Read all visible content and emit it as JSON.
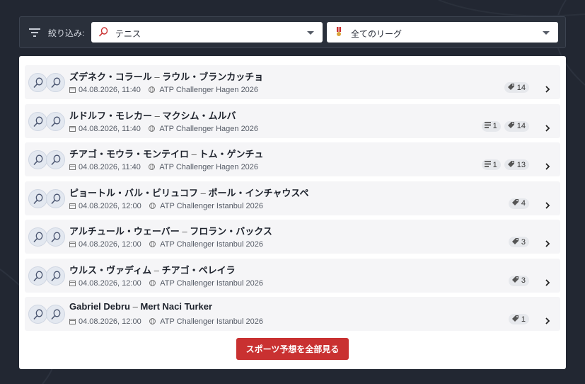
{
  "filter": {
    "label": "絞り込み:",
    "sport": "テニス",
    "league": "全てのリーグ"
  },
  "matches": [
    {
      "home": "ズデネク・コラール",
      "away": "ラウル・ブランカッチョ",
      "date": "04.08.2026, 11:40",
      "league": "ATP Challenger Hagen 2026",
      "news": "",
      "tips": "14"
    },
    {
      "home": "ルドルフ・モレカー",
      "away": "マクシム・ムルバ",
      "date": "04.08.2026, 11:40",
      "league": "ATP Challenger Hagen 2026",
      "news": "1",
      "tips": "14"
    },
    {
      "home": "チアゴ・モウラ・モンテイロ",
      "away": "トム・ゲンチュ",
      "date": "04.08.2026, 11:40",
      "league": "ATP Challenger Hagen 2026",
      "news": "1",
      "tips": "13"
    },
    {
      "home": "ピョートル・バル・ビリュコフ",
      "away": "ポール・インチャウスペ",
      "date": "04.08.2026, 12:00",
      "league": "ATP Challenger Istanbul 2026",
      "news": "",
      "tips": "4"
    },
    {
      "home": "アルチュール・ウェーバー",
      "away": "フロラン・バックス",
      "date": "04.08.2026, 12:00",
      "league": "ATP Challenger Istanbul 2026",
      "news": "",
      "tips": "3"
    },
    {
      "home": "ウルス・ヴァディム",
      "away": "チアゴ・ペレイラ",
      "date": "04.08.2026, 12:00",
      "league": "ATP Challenger Istanbul 2026",
      "news": "",
      "tips": "3"
    },
    {
      "home": "Gabriel Debru",
      "away": "Mert Naci Turker",
      "date": "04.08.2026, 12:00",
      "league": "ATP Challenger Istanbul 2026",
      "news": "",
      "tips": "1"
    }
  ],
  "separator": "–",
  "cta": "スポーツ予想を全部見る"
}
